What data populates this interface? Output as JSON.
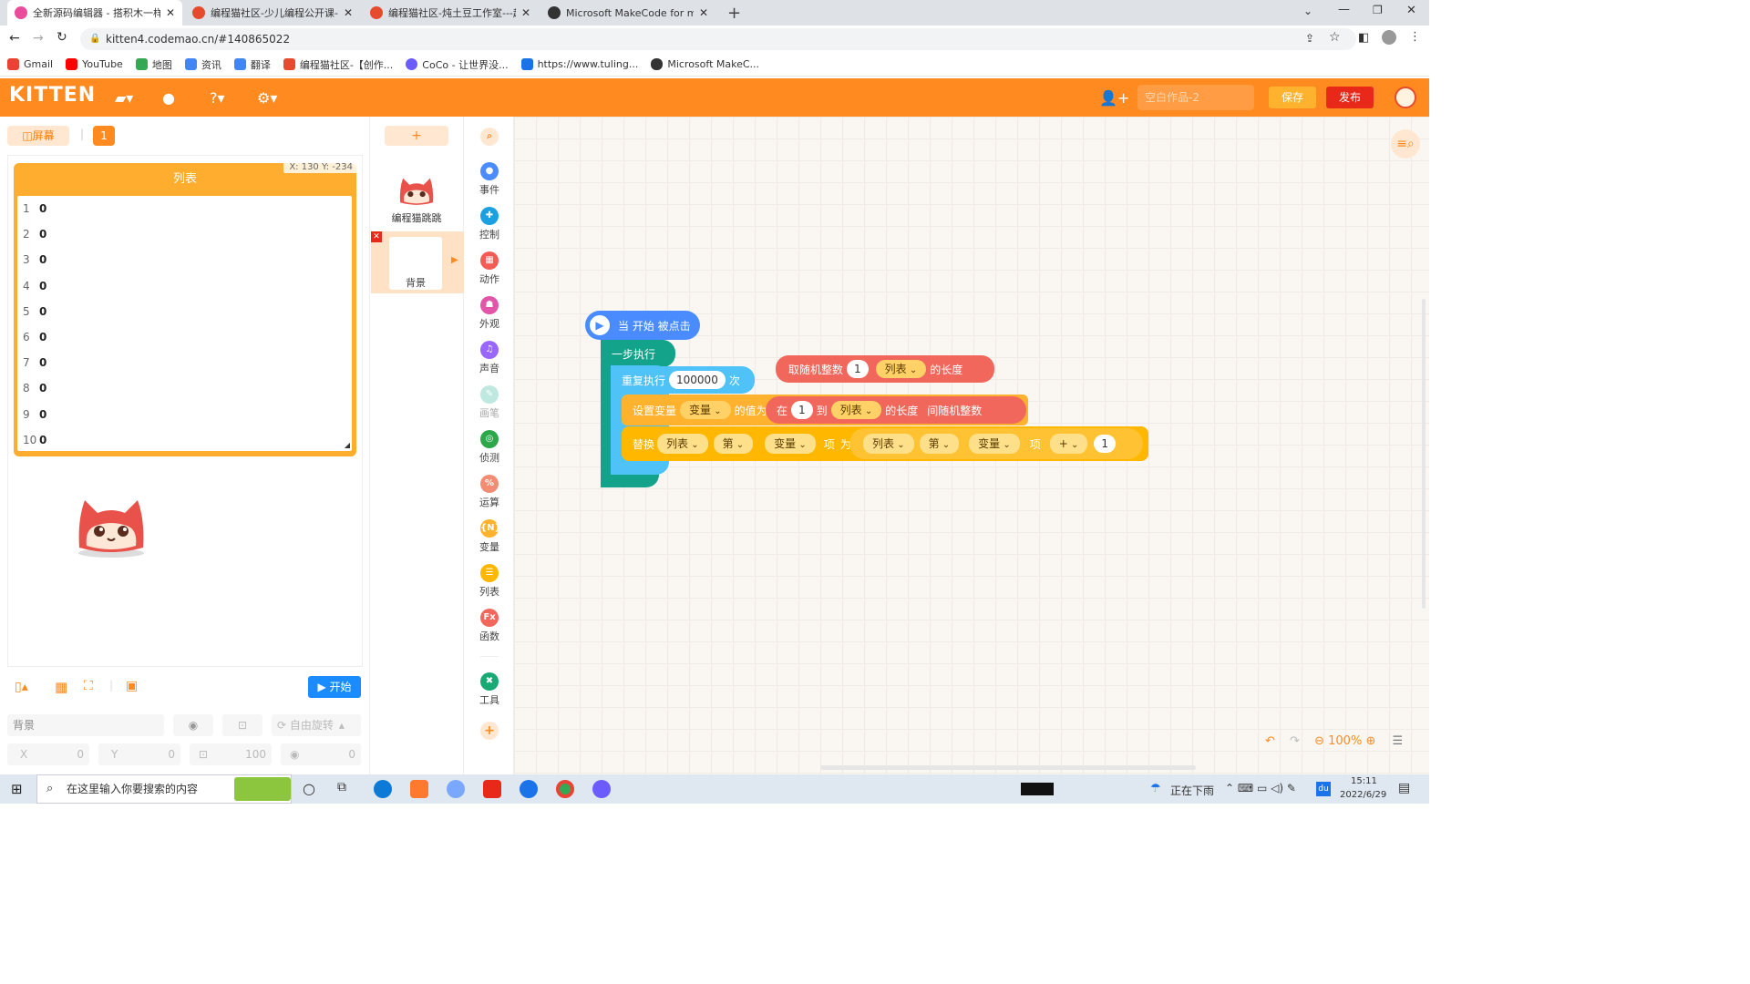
{
  "browser": {
    "tabs": [
      {
        "title": "全新源码编辑器 - 搭积木一样有"
      },
      {
        "title": "编程猫社区-少儿编程公开课-免"
      },
      {
        "title": "编程猫社区-炖土豆工作室---起"
      },
      {
        "title": "Microsoft MakeCode for mic"
      }
    ],
    "url": "kitten4.codemao.cn/#140865022",
    "bookmarks": [
      "Gmail",
      "YouTube",
      "地图",
      "资讯",
      "翻译",
      "编程猫社区-【创作...",
      "CoCo - 让世界没...",
      "https://www.tuling...",
      "Microsoft MakeC..."
    ]
  },
  "app": {
    "logo": "KITTEN",
    "project_placeholder": "空白作品-2",
    "save_label": "保存",
    "publish_label": "发布"
  },
  "stage": {
    "screen_label": "◫屏幕",
    "screen_number": "1",
    "list_title": "列表",
    "coord_readout": "X: 130    Y: -234",
    "list_rows": [
      {
        "idx": "1",
        "val": "0"
      },
      {
        "idx": "2",
        "val": "0"
      },
      {
        "idx": "3",
        "val": "0"
      },
      {
        "idx": "4",
        "val": "0"
      },
      {
        "idx": "5",
        "val": "0"
      },
      {
        "idx": "6",
        "val": "0"
      },
      {
        "idx": "7",
        "val": "0"
      },
      {
        "idx": "8",
        "val": "0"
      },
      {
        "idx": "9",
        "val": "0"
      },
      {
        "idx": "10",
        "val": "0"
      }
    ],
    "start_label": "开始",
    "props": {
      "name": "背景",
      "rotate_label": "自由旋转",
      "x_label": "X",
      "x_val": "0",
      "y_label": "Y",
      "y_val": "0",
      "size_val": "100",
      "dir_val": "0"
    }
  },
  "sprites": {
    "add_label": "+",
    "sprite1_name": "编程猫跳跳",
    "background_name": "背景"
  },
  "categories": [
    {
      "label": "事件",
      "color": "#4a8cff"
    },
    {
      "label": "控制",
      "color": "#1ba1e2"
    },
    {
      "label": "动作",
      "color": "#f25c54"
    },
    {
      "label": "外观",
      "color": "#e256a9"
    },
    {
      "label": "声音",
      "color": "#9966ff"
    },
    {
      "label": "画笔",
      "color": "#bfe8e0"
    },
    {
      "label": "侦测",
      "color": "#2aa84a"
    },
    {
      "label": "运算",
      "color": "#f28c73"
    },
    {
      "label": "变量",
      "color": "#ffb22e"
    },
    {
      "label": "列表",
      "color": "#ffb700"
    },
    {
      "label": "函数",
      "color": "#f2675c"
    },
    {
      "label": "工具",
      "color": "#19a974"
    }
  ],
  "blocks": {
    "hat": "当 开始 被点击",
    "step": "一步执行",
    "repeat_pre": "重复执行",
    "repeat_count": "100000",
    "repeat_post": "次",
    "rand": {
      "pre": "取随机整数",
      "num": "1",
      "list": "列表",
      "post": "的长度"
    },
    "setvar": {
      "pre": "设置变量",
      "var": "变量",
      "mid": "的值为",
      "in": "在",
      "num": "1",
      "to": "到",
      "list": "列表",
      "len": "的长度",
      "post": "间随机整数"
    },
    "replace": {
      "pre": "替换",
      "list": "列表",
      "nth": "第",
      "var": "变量",
      "item": "项",
      "as": "为",
      "list2": "列表",
      "nth2": "第",
      "var2": "变量",
      "item2": "项",
      "op": "+",
      "num": "1"
    }
  },
  "zoom": "100%",
  "taskbar": {
    "search_placeholder": "在这里输入你要搜索的内容",
    "weather": "正在下雨",
    "time": "15:11",
    "date": "2022/6/29",
    "ime": "du"
  }
}
